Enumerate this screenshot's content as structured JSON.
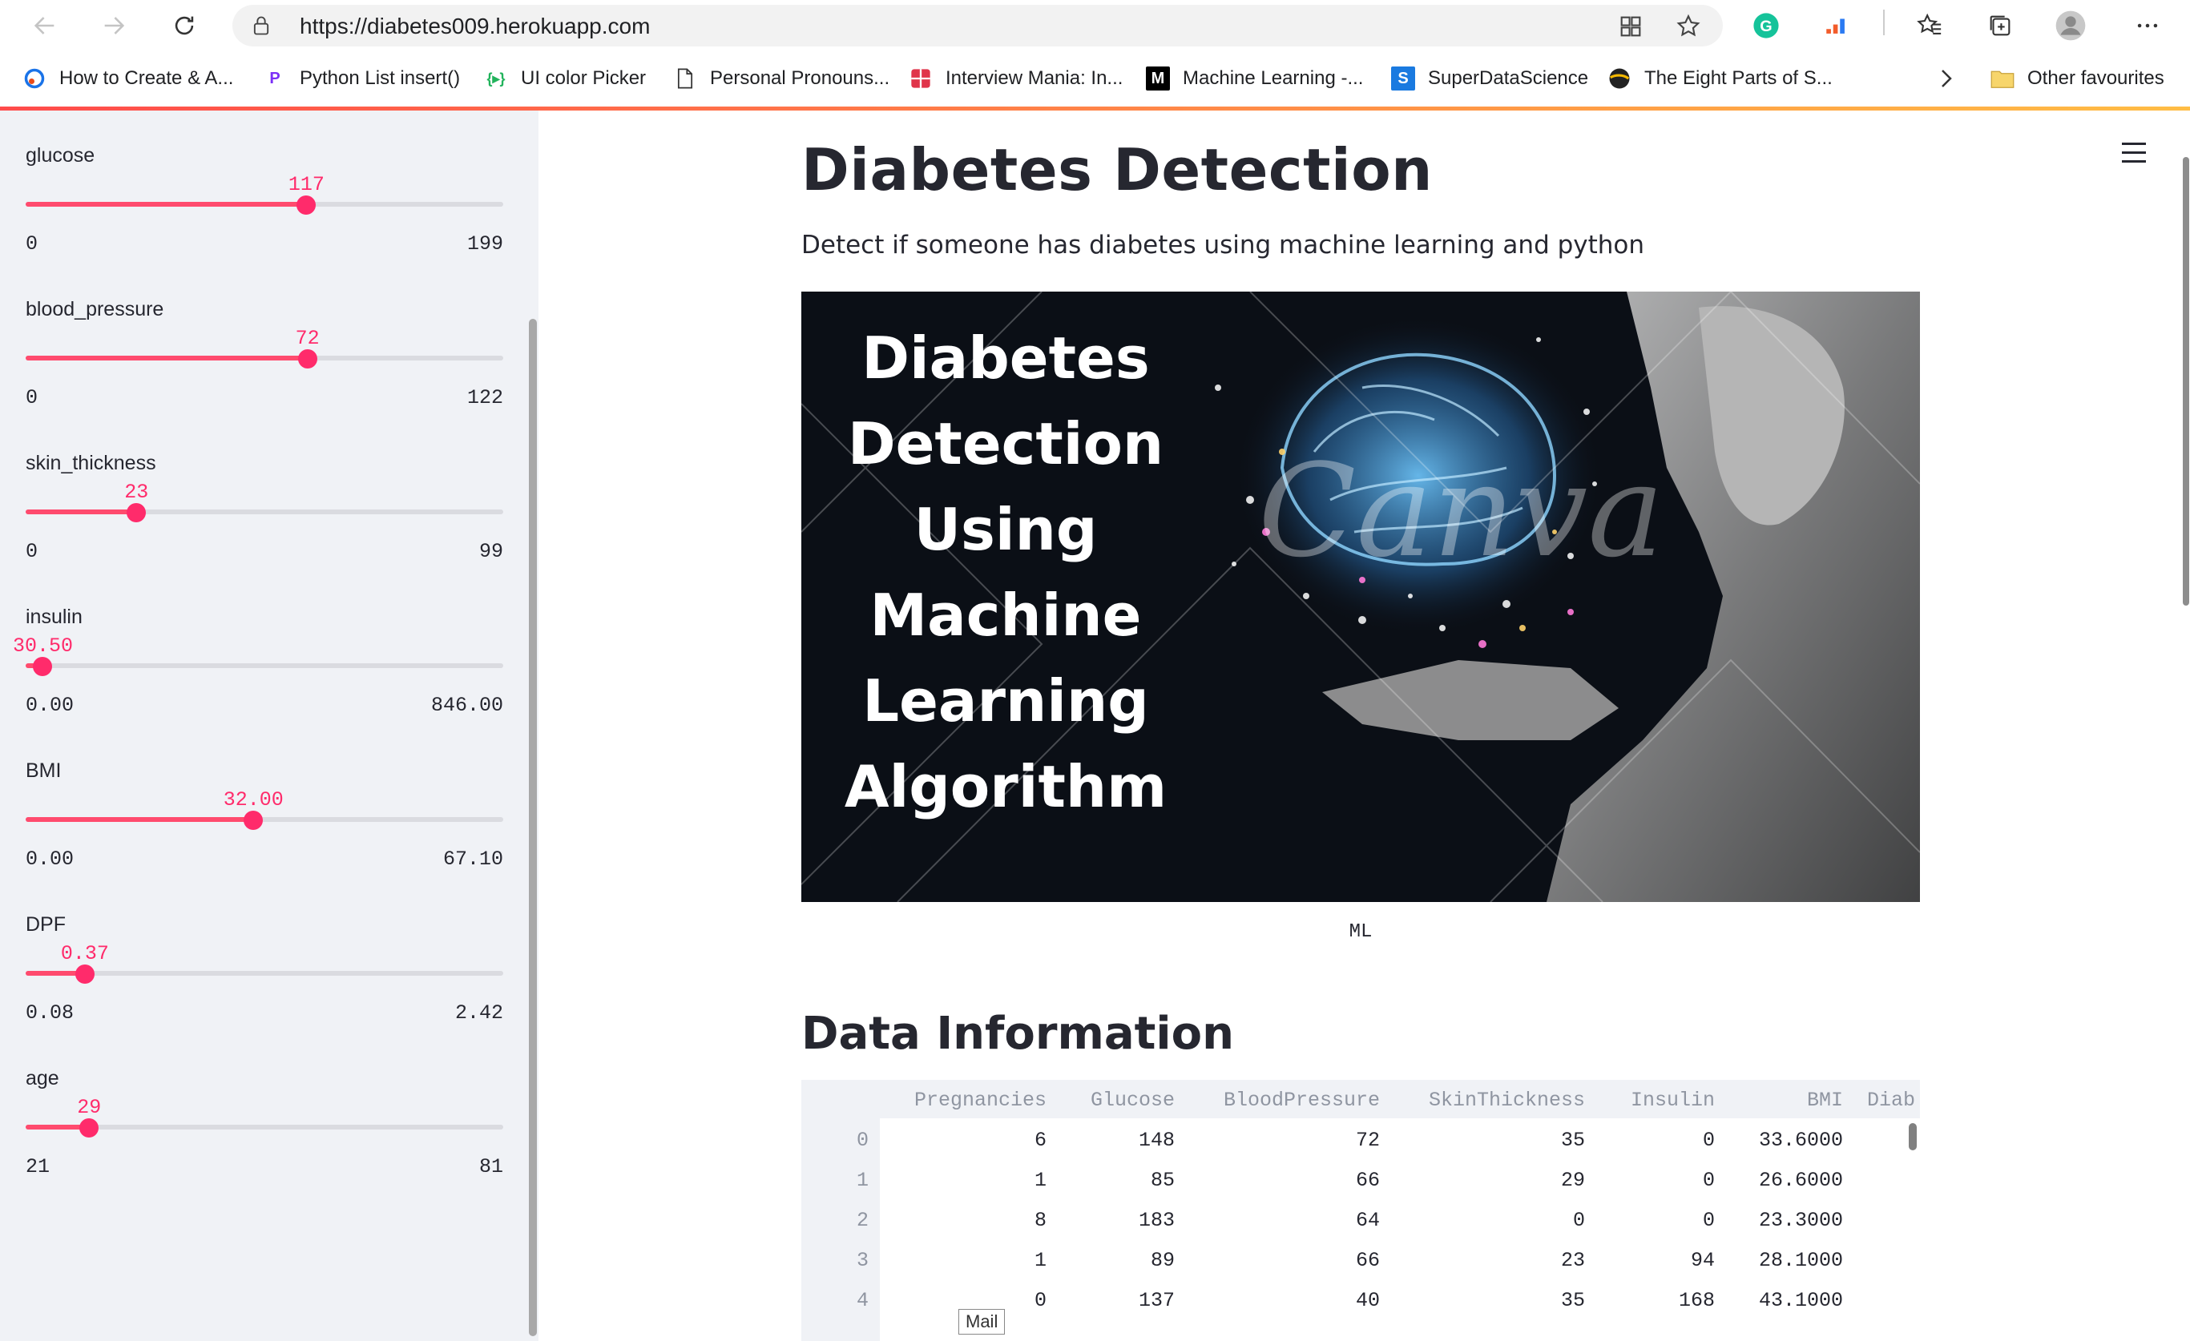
{
  "browser": {
    "url": "https://diabetes009.herokuapp.com",
    "bookmarks": [
      {
        "label": "How to Create & A...",
        "icon": "blue-circle-icon"
      },
      {
        "label": "Python List insert()",
        "icon": "purple-p-icon"
      },
      {
        "label": "UI color Picker",
        "icon": "green-bracket-icon"
      },
      {
        "label": "Personal Pronouns...",
        "icon": "page-icon"
      },
      {
        "label": "Interview Mania: In...",
        "icon": "red-grid-icon"
      },
      {
        "label": "Machine Learning -...",
        "icon": "medium-m-icon"
      },
      {
        "label": "SuperDataScience",
        "icon": "blue-s-icon"
      },
      {
        "label": "The Eight Parts of S...",
        "icon": "globe-icon"
      }
    ],
    "other_favourites": "Other favourites"
  },
  "sidebar": {
    "sliders": [
      {
        "label": "glucose",
        "value": "117",
        "min": "0",
        "max": "199",
        "fraction": 0.588
      },
      {
        "label": "blood_pressure",
        "value": "72",
        "min": "0",
        "max": "122",
        "fraction": 0.59
      },
      {
        "label": "skin_thickness",
        "value": "23",
        "min": "0",
        "max": "99",
        "fraction": 0.232
      },
      {
        "label": "insulin",
        "value": "30.50",
        "min": "0.00",
        "max": "846.00",
        "fraction": 0.036
      },
      {
        "label": "BMI",
        "value": "32.00",
        "min": "0.00",
        "max": "67.10",
        "fraction": 0.477
      },
      {
        "label": "DPF",
        "value": "0.37",
        "min": "0.08",
        "max": "2.42",
        "fraction": 0.124
      },
      {
        "label": "age",
        "value": "29",
        "min": "21",
        "max": "81",
        "fraction": 0.133
      }
    ]
  },
  "main": {
    "title": "Diabetes Detection",
    "subtitle": "Detect if someone has diabetes using machine learning and python",
    "banner": {
      "lines": [
        "Diabetes",
        "Detection",
        "Using",
        "Machine",
        "Learning",
        "Algorithm"
      ],
      "watermark": "Canva"
    },
    "caption": "ML",
    "section_title": "Data Information",
    "table": {
      "columns": [
        "Pregnancies",
        "Glucose",
        "BloodPressure",
        "SkinThickness",
        "Insulin",
        "BMI",
        "Diab"
      ],
      "rows": [
        {
          "index": "0",
          "cells": [
            "6",
            "148",
            "72",
            "35",
            "0",
            "33.6000"
          ]
        },
        {
          "index": "1",
          "cells": [
            "1",
            "85",
            "66",
            "29",
            "0",
            "26.6000"
          ]
        },
        {
          "index": "2",
          "cells": [
            "8",
            "183",
            "64",
            "0",
            "0",
            "23.3000"
          ]
        },
        {
          "index": "3",
          "cells": [
            "1",
            "89",
            "66",
            "23",
            "94",
            "28.1000"
          ]
        },
        {
          "index": "4",
          "cells": [
            "0",
            "137",
            "40",
            "35",
            "168",
            "43.1000"
          ]
        }
      ]
    },
    "tooltip": "Mail"
  },
  "colors": {
    "accent": "#ff2b6b",
    "sidebar_bg": "#f0f2f6",
    "text": "#262730"
  }
}
